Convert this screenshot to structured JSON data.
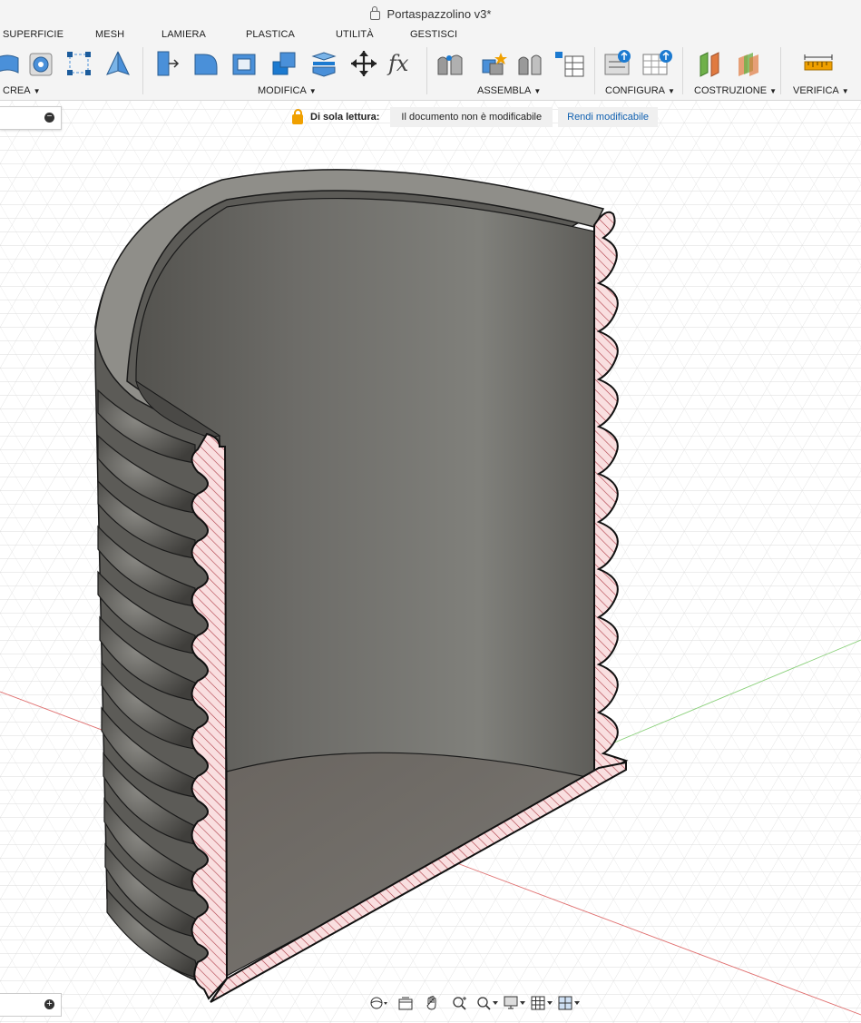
{
  "app": {
    "title": "Portaspazzolino v3*"
  },
  "tabs": [
    "SUPERFICIE",
    "MESH",
    "LAMIERA",
    "PLASTICA",
    "UTILITÀ",
    "GESTISCI"
  ],
  "groups": {
    "crea": "CREA",
    "modifica": "MODIFICA",
    "assembla": "ASSEMBLA",
    "configura": "CONFIGURA",
    "costruzione": "COSTRUZIONE",
    "verifica": "VERIFICA"
  },
  "tools": {
    "crea": [
      "box-icon",
      "revolve-icon",
      "sketch-icon",
      "prism-icon"
    ],
    "modifica": [
      "pushpull-icon",
      "fillet-icon",
      "shell-icon",
      "combine-icon",
      "split-icon",
      "move-icon",
      "parameters-icon"
    ],
    "assembla": [
      "joint-icon",
      "new-component-icon",
      "as-built-joint-icon",
      "table-icon"
    ],
    "configura": [
      "configure-icon",
      "configure-table-icon"
    ],
    "costruzione": [
      "offset-plane-icon",
      "midplane-icon"
    ],
    "verifica": [
      "measure-icon"
    ]
  },
  "notice": {
    "label": "Di sola lettura:",
    "message": "Il documento non è modificabile",
    "action": "Rendi modificabile"
  },
  "browser_panel": {
    "toggle": "−"
  },
  "comments_panel": {
    "toggle": "+"
  },
  "navbar": [
    "orbit-icon",
    "look-at-icon",
    "pan-icon",
    "zoom-icon",
    "fit-icon",
    "display-settings-icon",
    "grid-icon",
    "viewports-icon"
  ],
  "colors": {
    "accent": "#1060b0",
    "warning": "#f0a000",
    "section_fill": "#f9dfe0",
    "model": "#6e6d69"
  }
}
